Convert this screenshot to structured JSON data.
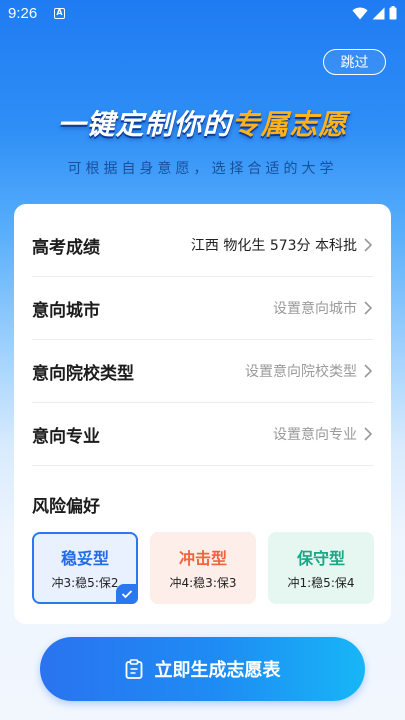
{
  "status": {
    "time": "9:26",
    "notification": "A"
  },
  "header": {
    "skip_label": "跳过",
    "headline_part1": "一键定制你的",
    "headline_part2": "专属志愿",
    "subline": "可根据自身意愿，选择合适的大学"
  },
  "form": {
    "rows": [
      {
        "label": "高考成绩",
        "value": "江西  物化生  573分  本科批"
      },
      {
        "label": "意向城市",
        "value": "设置意向城市"
      },
      {
        "label": "意向院校类型",
        "value": "设置意向院校类型"
      },
      {
        "label": "意向专业",
        "value": "设置意向专业"
      }
    ],
    "risk_title": "风险偏好",
    "options": [
      {
        "title": "稳妥型",
        "desc": "冲3:稳5:保2",
        "selected": true
      },
      {
        "title": "冲击型",
        "desc": "冲4:稳3:保3",
        "selected": false
      },
      {
        "title": "保守型",
        "desc": "冲1:稳5:保4",
        "selected": false
      }
    ]
  },
  "action": {
    "generate_label": "立即生成志愿表"
  },
  "colors": {
    "primary": "#2a78f0",
    "accent": "#ffb21c",
    "rush": "#f0643c",
    "safe": "#17a885"
  }
}
